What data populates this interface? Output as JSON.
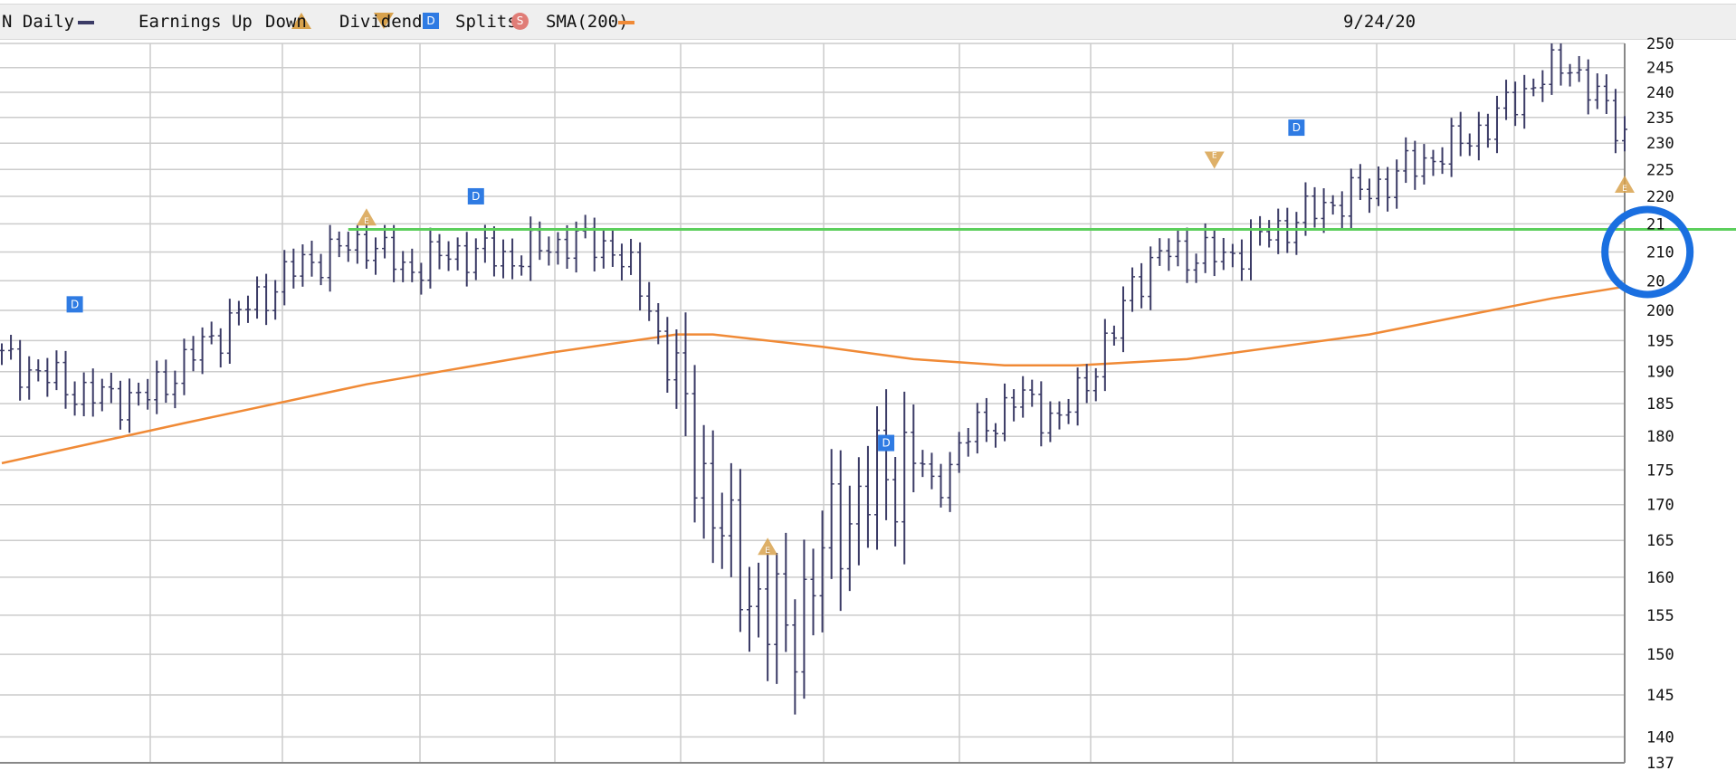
{
  "legend": {
    "price_label": "N Daily",
    "earnings_label": "Earnings Up",
    "down_label": "Down",
    "dividends_label": "Dividends",
    "splits_label": "Splits",
    "sma_label": "SMA(200)",
    "date": "9/24/20",
    "marker_letters": {
      "earnings": "E",
      "dividend": "D",
      "split": "S"
    }
  },
  "colors": {
    "price": "#3b3b66",
    "sma": "#f08a36",
    "support_line": "#5ccf5c",
    "dividend": "#2f7be3",
    "earnings": "#d8a24d",
    "split": "#e07d77",
    "annotation_circle": "#1a6fe0",
    "grid": "#cccccc"
  },
  "chart_data": {
    "type": "line",
    "title": "",
    "xlabel": "",
    "ylabel": "",
    "y_scale": "log",
    "ylim": [
      137,
      250
    ],
    "yticks": [
      250,
      245,
      240,
      235,
      230,
      225,
      220,
      215,
      210,
      205,
      200,
      195,
      190,
      185,
      180,
      175,
      170,
      165,
      160,
      155,
      150,
      145,
      140,
      137
    ],
    "ytick_labels": [
      "250",
      "245",
      "240",
      "235",
      "230",
      "225",
      "220",
      "21",
      "210",
      "20",
      "200",
      "195",
      "190",
      "185",
      "180",
      "175",
      "170",
      "165",
      "160",
      "155",
      "150",
      "145",
      "140",
      "137"
    ],
    "grid": true,
    "x_index_range": [
      0,
      178
    ],
    "series": [
      {
        "kind": "price_bars",
        "x": [
          0,
          10,
          16,
          25,
          33,
          40,
          44,
          50,
          56,
          62,
          67,
          71,
          74,
          80,
          86,
          92,
          100,
          102,
          106,
          112,
          116,
          122,
          124,
          128,
          134,
          140,
          146,
          150,
          154,
          160,
          164,
          168,
          172,
          174,
          176,
          178
        ],
        "y": [
          192,
          186,
          186,
          198,
          208,
          212,
          207,
          210,
          209,
          212,
          211,
          201,
          186,
          162,
          152,
          168,
          178,
          172,
          180,
          186,
          182,
          196,
          205,
          210,
          209,
          214,
          219,
          221,
          225,
          230,
          235,
          242,
          246,
          241,
          236,
          232
        ]
      },
      {
        "name": "SMA(200)",
        "kind": "line",
        "x": [
          0,
          20,
          40,
          60,
          74,
          78,
          90,
          100,
          110,
          118,
          130,
          140,
          150,
          160,
          170,
          178
        ],
        "y": [
          176,
          182,
          188,
          193,
          196,
          196,
          194,
          192,
          191,
          191,
          192,
          194,
          196,
          199,
          202,
          204
        ]
      },
      {
        "kind": "horizontal_line",
        "x": [
          38,
          192
        ],
        "y": [
          214,
          214
        ]
      }
    ],
    "events": {
      "dividends": [
        {
          "x": 8,
          "y": 201
        },
        {
          "x": 52,
          "y": 220
        },
        {
          "x": 97,
          "y": 179
        },
        {
          "x": 142,
          "y": 233
        }
      ],
      "earnings_up": [
        {
          "x": 40,
          "y": 216
        },
        {
          "x": 84,
          "y": 164
        },
        {
          "x": 178,
          "y": 222
        }
      ],
      "earnings_down": [
        {
          "x": 133,
          "y": 227
        }
      ]
    },
    "annotation": {
      "kind": "circle",
      "x": 180.5,
      "y": 210
    }
  }
}
